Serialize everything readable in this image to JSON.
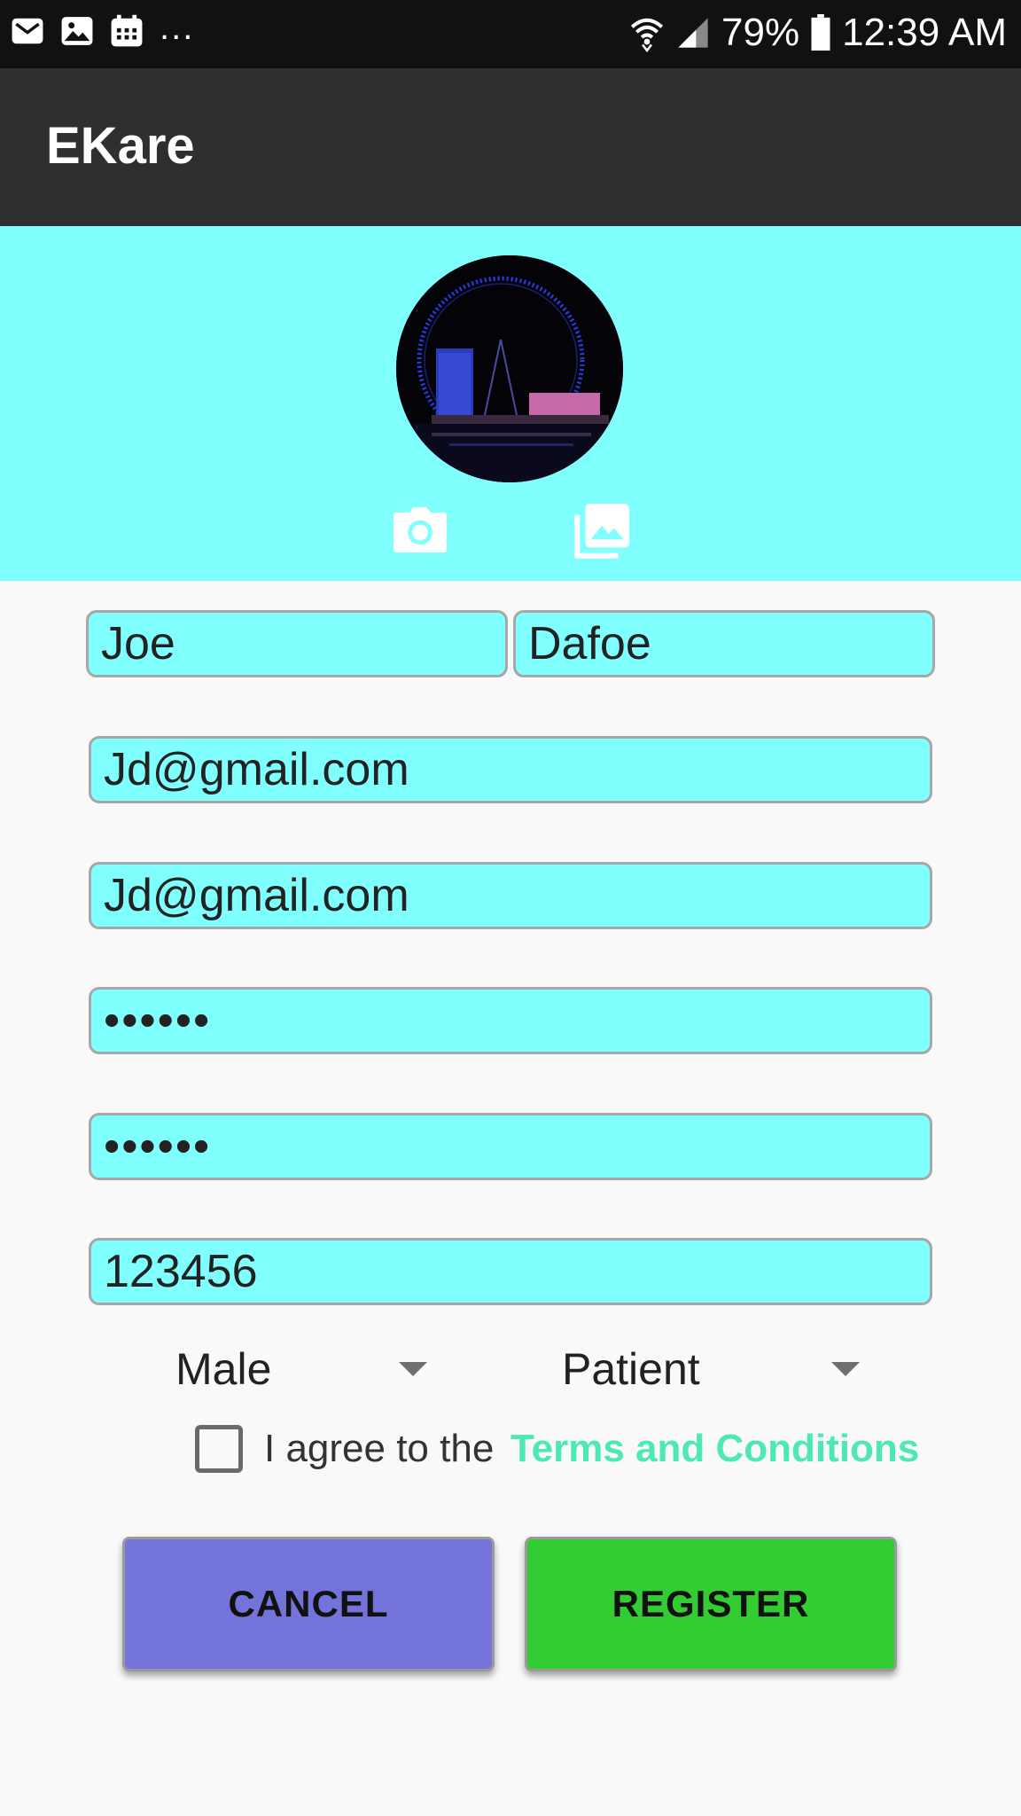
{
  "status_bar": {
    "battery": "79%",
    "time": "12:39 AM",
    "more": "...",
    "left_icons": [
      "mail-icon",
      "image-icon",
      "calendar-icon"
    ],
    "right_icons": [
      "wifi-icon",
      "signal-icon",
      "battery-icon"
    ]
  },
  "app_bar": {
    "title": "EKare"
  },
  "header": {
    "background": "#80ffff",
    "camera_icon": "camera-icon",
    "gallery_icon": "gallery-icon"
  },
  "form": {
    "first_name": "Joe",
    "last_name": "Dafoe",
    "email": "Jd@gmail.com",
    "confirm_email": "Jd@gmail.com",
    "password": "••••••",
    "confirm_password": "••••••",
    "code": "123456",
    "gender": "Male",
    "role": "Patient",
    "agree_text": "I agree to the",
    "terms_link": "Terms and Conditions",
    "field_color": "#80ffff"
  },
  "buttons": {
    "cancel": "CANCEL",
    "register": "REGISTER",
    "cancel_color": "#7373d9",
    "register_color": "#33cc33"
  }
}
